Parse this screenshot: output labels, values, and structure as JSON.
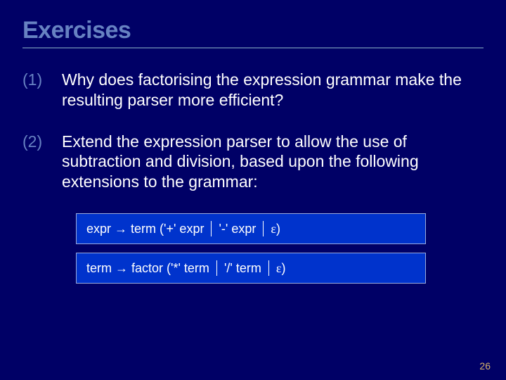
{
  "title": "Exercises",
  "items": [
    {
      "num": "(1)",
      "body": "Why does factorising the expression grammar make the resulting parser more efficient?"
    },
    {
      "num": "(2)",
      "body": "Extend the expression parser to allow the use of subtraction and division, based upon the following extensions to the grammar:"
    }
  ],
  "grammar": {
    "line1": {
      "lhs": "expr",
      "arrow": "→",
      "alt1": "term ('+' expr",
      "alt2": "'-' expr",
      "eps": "ε",
      "close": ")"
    },
    "line2": {
      "lhs": "term",
      "arrow": "→",
      "alt1": "factor ('*' term",
      "alt2": "'/' term",
      "eps": "ε",
      "close": ")"
    }
  },
  "pagenum": "26"
}
